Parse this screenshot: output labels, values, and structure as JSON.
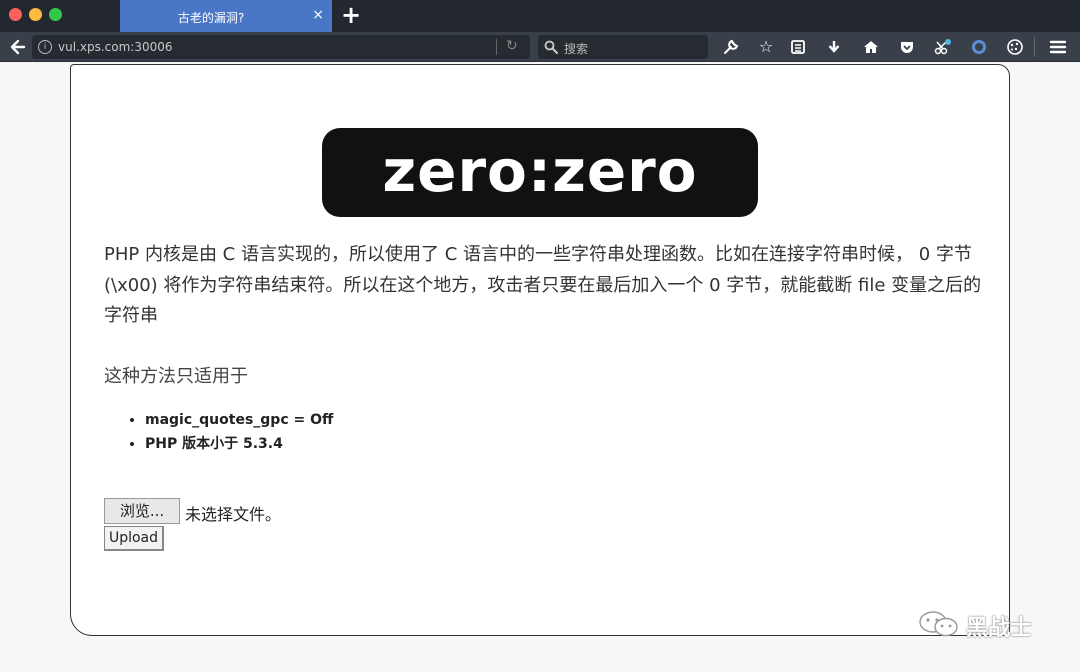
{
  "browser": {
    "tab_title": "古老的漏洞?",
    "tab_close": "×",
    "new_tab": "+",
    "url": "vul.xps.com:30006",
    "search_placeholder": "搜索"
  },
  "toolbar_icons": [
    "wrench-icon",
    "bookmark-star-icon",
    "reader-list-icon",
    "download-icon",
    "home-icon",
    "pocket-icon",
    "screenshot-icon",
    "circle-icon",
    "cookie-icon",
    "menu-icon"
  ],
  "page": {
    "logo_text": "zero:zero",
    "paragraph": "PHP 内核是由 C 语言实现的，所以使用了 C 语言中的一些字符串处理函数。比如在连接字符串时候， 0 字节 (\\x00) 将作为字符串结束符。所以在这个地方，攻击者只要在最后加入一个 0 字节，就能截断 file 变量之后的字符串",
    "subheading": "这种方法只适用于",
    "conditions": [
      "magic_quotes_gpc = Off",
      "PHP 版本小于 5.3.4"
    ],
    "browse_label": "浏览...",
    "file_status": "未选择文件。",
    "upload_label": "Upload"
  },
  "watermark": {
    "text": "黑战士"
  },
  "colors": {
    "titlebar": "#232830",
    "active_tab": "#4a76c6",
    "navbar": "#3a404a",
    "page_bg": "#ffffff",
    "logo_bg": "#111111"
  }
}
